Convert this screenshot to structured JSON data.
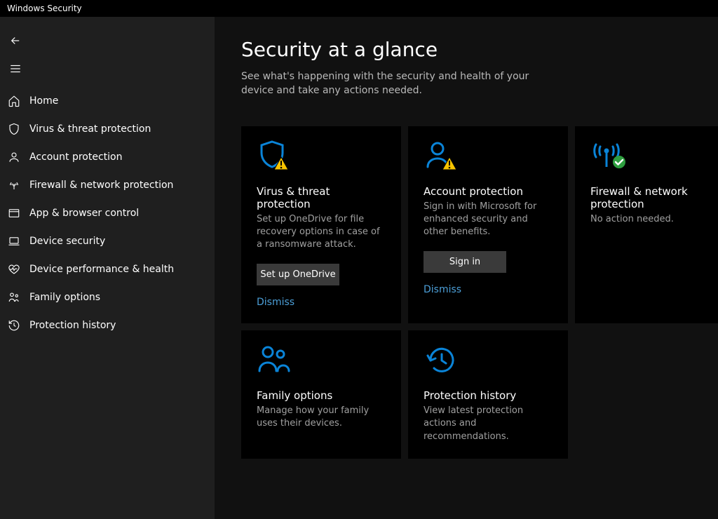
{
  "window": {
    "title": "Windows Security"
  },
  "sidebar": {
    "items": [
      {
        "label": "Home"
      },
      {
        "label": "Virus & threat protection"
      },
      {
        "label": "Account protection"
      },
      {
        "label": "Firewall & network protection"
      },
      {
        "label": "App & browser control"
      },
      {
        "label": "Device security"
      },
      {
        "label": "Device performance & health"
      },
      {
        "label": "Family options"
      },
      {
        "label": "Protection history"
      }
    ]
  },
  "main": {
    "title": "Security at a glance",
    "subtitle": "See what's happening with the security and health of your device and take any actions needed."
  },
  "cards": {
    "virus": {
      "title": "Virus & threat protection",
      "desc": "Set up OneDrive for file recovery options in case of a ransomware attack.",
      "button": "Set up OneDrive",
      "dismiss": "Dismiss"
    },
    "account": {
      "title": "Account protection",
      "desc": "Sign in with Microsoft for enhanced security and other benefits.",
      "button": "Sign in",
      "dismiss": "Dismiss"
    },
    "firewall": {
      "title": "Firewall & network protection",
      "desc": "No action needed."
    },
    "family": {
      "title": "Family options",
      "desc": "Manage how your family uses their devices."
    },
    "history": {
      "title": "Protection history",
      "desc": "View latest protection actions and recommendations."
    }
  }
}
